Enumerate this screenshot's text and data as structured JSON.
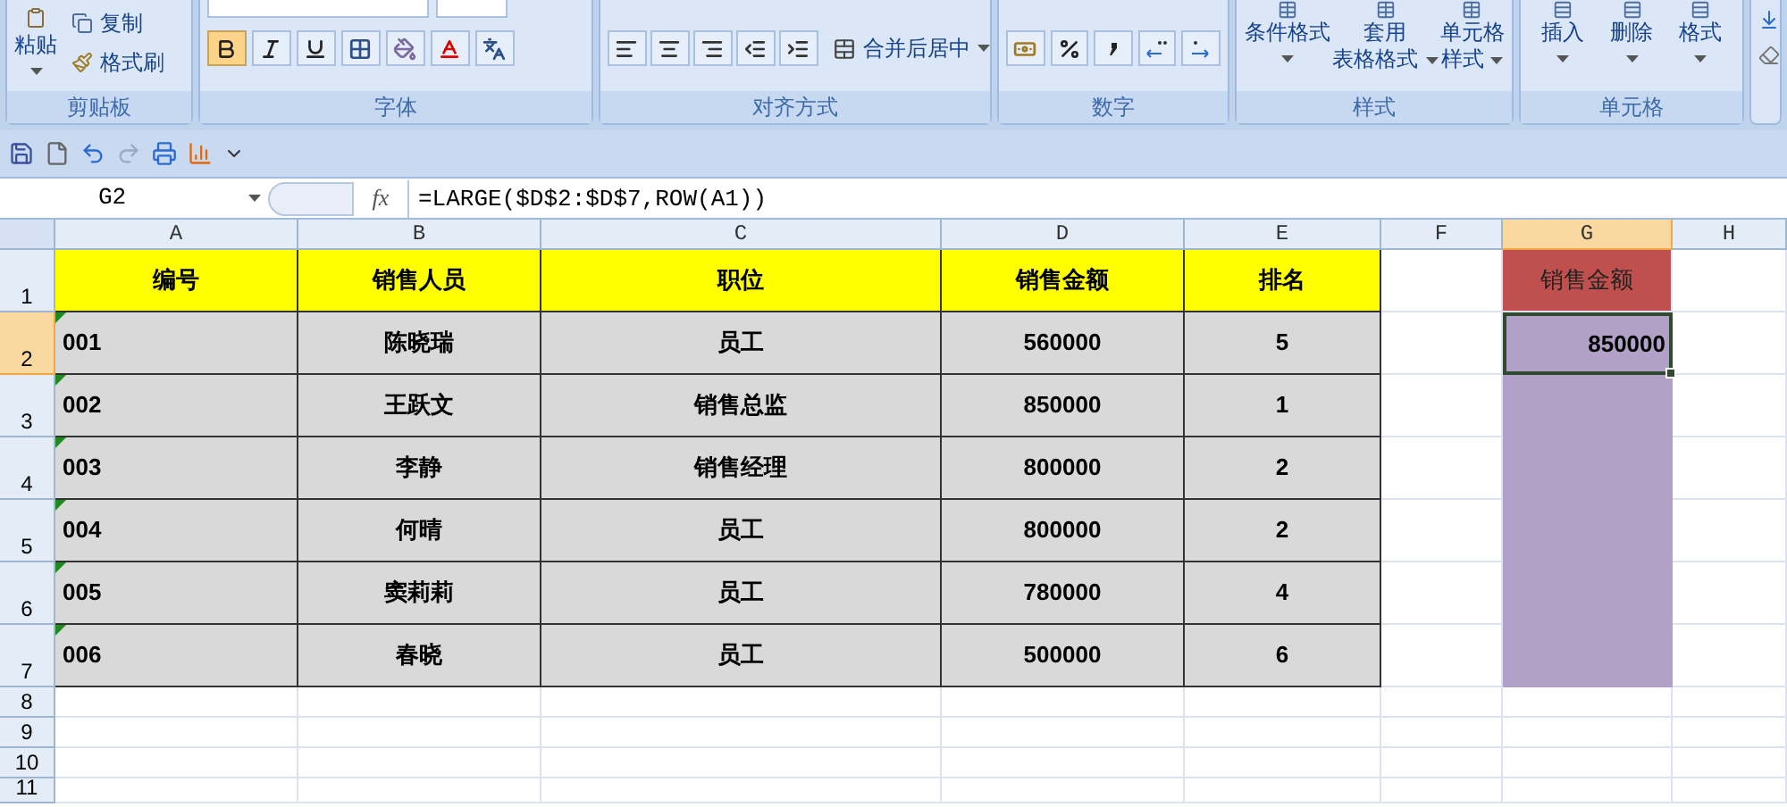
{
  "ribbon": {
    "groups": [
      {
        "label": "剪贴板",
        "kind": "clipboard",
        "buttons": [
          {
            "label": "粘贴",
            "kind": "paste"
          },
          {
            "label": "复制",
            "kind": "copy"
          },
          {
            "label": "格式刷",
            "kind": "painter"
          }
        ]
      },
      {
        "label": "字体",
        "kind": "font",
        "buttons": [
          {
            "kind": "bold",
            "selected": true
          },
          {
            "kind": "italic",
            "selected": false
          },
          {
            "kind": "underline",
            "selected": false
          }
        ]
      },
      {
        "label": "对齐方式",
        "kind": "align",
        "buttons": [
          {
            "label": "合并后居中",
            "kind": "merge"
          }
        ]
      },
      {
        "label": "数字",
        "kind": "number"
      },
      {
        "label": "样式",
        "kind": "styles",
        "buttons": [
          {
            "label": "条件格式"
          },
          {
            "label": "套用",
            "label2": "表格格式"
          },
          {
            "label": "单元格",
            "label2": "样式"
          }
        ]
      },
      {
        "label": "单元格",
        "kind": "cells",
        "buttons": [
          {
            "label": "插入"
          },
          {
            "label": "删除"
          },
          {
            "label": "格式"
          }
        ]
      }
    ]
  },
  "formula_bar": {
    "name_box": "G2",
    "function_label": "fx",
    "formula": "=LARGE($D$2:$D$7,ROW(A1))"
  },
  "columns": [
    {
      "label": "A",
      "selected": false
    },
    {
      "label": "B",
      "selected": false
    },
    {
      "label": "C",
      "selected": false
    },
    {
      "label": "D",
      "selected": false
    },
    {
      "label": "E",
      "selected": false
    },
    {
      "label": "F",
      "selected": false
    },
    {
      "label": "G",
      "selected": true
    },
    {
      "label": "H",
      "selected": false
    }
  ],
  "rows": [
    {
      "number": "1",
      "selected": false,
      "cells": [
        {
          "text": "编号",
          "kind": "header",
          "selected": false
        },
        {
          "text": "销售人员",
          "kind": "header",
          "selected": false
        },
        {
          "text": "职位",
          "kind": "header",
          "selected": false
        },
        {
          "text": "销售金额",
          "kind": "header",
          "selected": false
        },
        {
          "text": "排名",
          "kind": "header",
          "selected": false
        },
        {
          "kind": "empty",
          "selected": false
        },
        {
          "text": "销售金额",
          "kind": "result_header",
          "selected": false
        },
        {
          "kind": "empty",
          "selected": false
        }
      ]
    },
    {
      "number": "2",
      "selected": true,
      "cells": [
        {
          "text": "001",
          "kind": "id",
          "selected": false
        },
        {
          "text": "陈晓瑞",
          "kind": "data",
          "selected": false
        },
        {
          "text": "员工",
          "kind": "data",
          "selected": false
        },
        {
          "text": "560000",
          "kind": "data",
          "selected": false
        },
        {
          "text": "5",
          "kind": "data",
          "selected": false
        },
        {
          "kind": "empty",
          "selected": false
        },
        {
          "text": "850000",
          "kind": "result",
          "selected": true
        },
        {
          "kind": "empty",
          "selected": false
        }
      ]
    },
    {
      "number": "3",
      "selected": false,
      "cells": [
        {
          "text": "002",
          "kind": "id",
          "selected": false
        },
        {
          "text": "王跃文",
          "kind": "data",
          "selected": false
        },
        {
          "text": "销售总监",
          "kind": "data",
          "selected": false
        },
        {
          "text": "850000",
          "kind": "data",
          "selected": false
        },
        {
          "text": "1",
          "kind": "data",
          "selected": false
        },
        {
          "kind": "empty",
          "selected": false
        },
        {
          "kind": "result",
          "selected": false
        },
        {
          "kind": "empty",
          "selected": false
        }
      ]
    },
    {
      "number": "4",
      "selected": false,
      "cells": [
        {
          "text": "003",
          "kind": "id",
          "selected": false
        },
        {
          "text": "李静",
          "kind": "data",
          "selected": false
        },
        {
          "text": "销售经理",
          "kind": "data",
          "selected": false
        },
        {
          "text": "800000",
          "kind": "data",
          "selected": false
        },
        {
          "text": "2",
          "kind": "data",
          "selected": false
        },
        {
          "kind": "empty",
          "selected": false
        },
        {
          "kind": "result",
          "selected": false
        },
        {
          "kind": "empty",
          "selected": false
        }
      ]
    },
    {
      "number": "5",
      "selected": false,
      "cells": [
        {
          "text": "004",
          "kind": "id",
          "selected": false
        },
        {
          "text": "何晴",
          "kind": "data",
          "selected": false
        },
        {
          "text": "员工",
          "kind": "data",
          "selected": false
        },
        {
          "text": "800000",
          "kind": "data",
          "selected": false
        },
        {
          "text": "2",
          "kind": "data",
          "selected": false
        },
        {
          "kind": "empty",
          "selected": false
        },
        {
          "kind": "result",
          "selected": false
        },
        {
          "kind": "empty",
          "selected": false
        }
      ]
    },
    {
      "number": "6",
      "selected": false,
      "cells": [
        {
          "text": "005",
          "kind": "id",
          "selected": false
        },
        {
          "text": "窦莉莉",
          "kind": "data",
          "selected": false
        },
        {
          "text": "员工",
          "kind": "data",
          "selected": false
        },
        {
          "text": "780000",
          "kind": "data",
          "selected": false
        },
        {
          "text": "4",
          "kind": "data",
          "selected": false
        },
        {
          "kind": "empty",
          "selected": false
        },
        {
          "kind": "result",
          "selected": false
        },
        {
          "kind": "empty",
          "selected": false
        }
      ]
    },
    {
      "number": "7",
      "selected": false,
      "cells": [
        {
          "text": "006",
          "kind": "id",
          "selected": false
        },
        {
          "text": "春晓",
          "kind": "data",
          "selected": false
        },
        {
          "text": "员工",
          "kind": "data",
          "selected": false
        },
        {
          "text": "500000",
          "kind": "data",
          "selected": false
        },
        {
          "text": "6",
          "kind": "data",
          "selected": false
        },
        {
          "kind": "empty",
          "selected": false
        },
        {
          "kind": "result",
          "selected": false
        },
        {
          "kind": "empty",
          "selected": false
        }
      ]
    },
    {
      "number": "8",
      "selected": false,
      "cells": []
    },
    {
      "number": "9",
      "selected": false,
      "cells": []
    },
    {
      "number": "10",
      "selected": false,
      "cells": []
    },
    {
      "number": "11",
      "selected": false,
      "cells": []
    }
  ]
}
